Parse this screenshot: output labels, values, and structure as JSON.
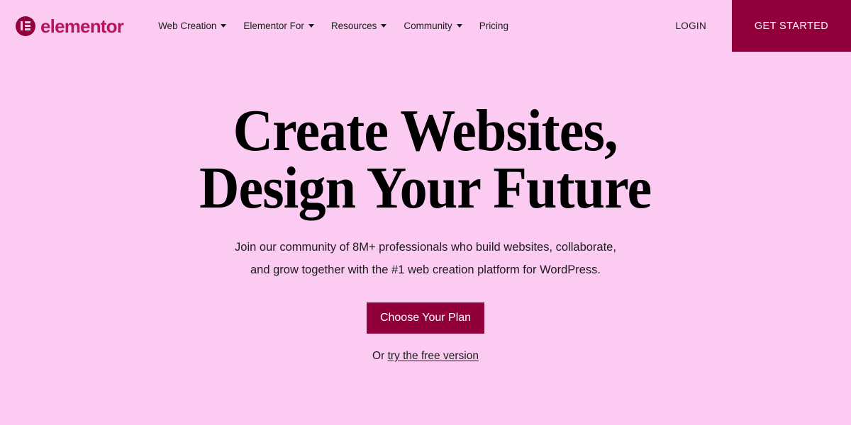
{
  "theme": {
    "background": "#fbcbf2",
    "brand_accent": "#92003b",
    "logo_text_color": "#b8155f",
    "text_color": "#1c1c1c",
    "headline_color": "#000000"
  },
  "header": {
    "logo": {
      "icon": "elementor-logo-icon",
      "wordmark": "elementor"
    },
    "nav": [
      {
        "label": "Web Creation",
        "has_dropdown": true
      },
      {
        "label": "Elementor For",
        "has_dropdown": true
      },
      {
        "label": "Resources",
        "has_dropdown": true
      },
      {
        "label": "Community",
        "has_dropdown": true
      },
      {
        "label": "Pricing",
        "has_dropdown": false
      }
    ],
    "login_label": "LOGIN",
    "get_started_label": "GET STARTED"
  },
  "hero": {
    "headline_line1": "Create Websites,",
    "headline_line2": "Design Your Future",
    "subtitle_line1": "Join our community of 8M+ professionals who build websites, collaborate,",
    "subtitle_line2": "and grow together with the #1 web creation platform for WordPress.",
    "cta_label": "Choose Your Plan",
    "secondary_prefix": "Or ",
    "secondary_link": "try the free version"
  }
}
